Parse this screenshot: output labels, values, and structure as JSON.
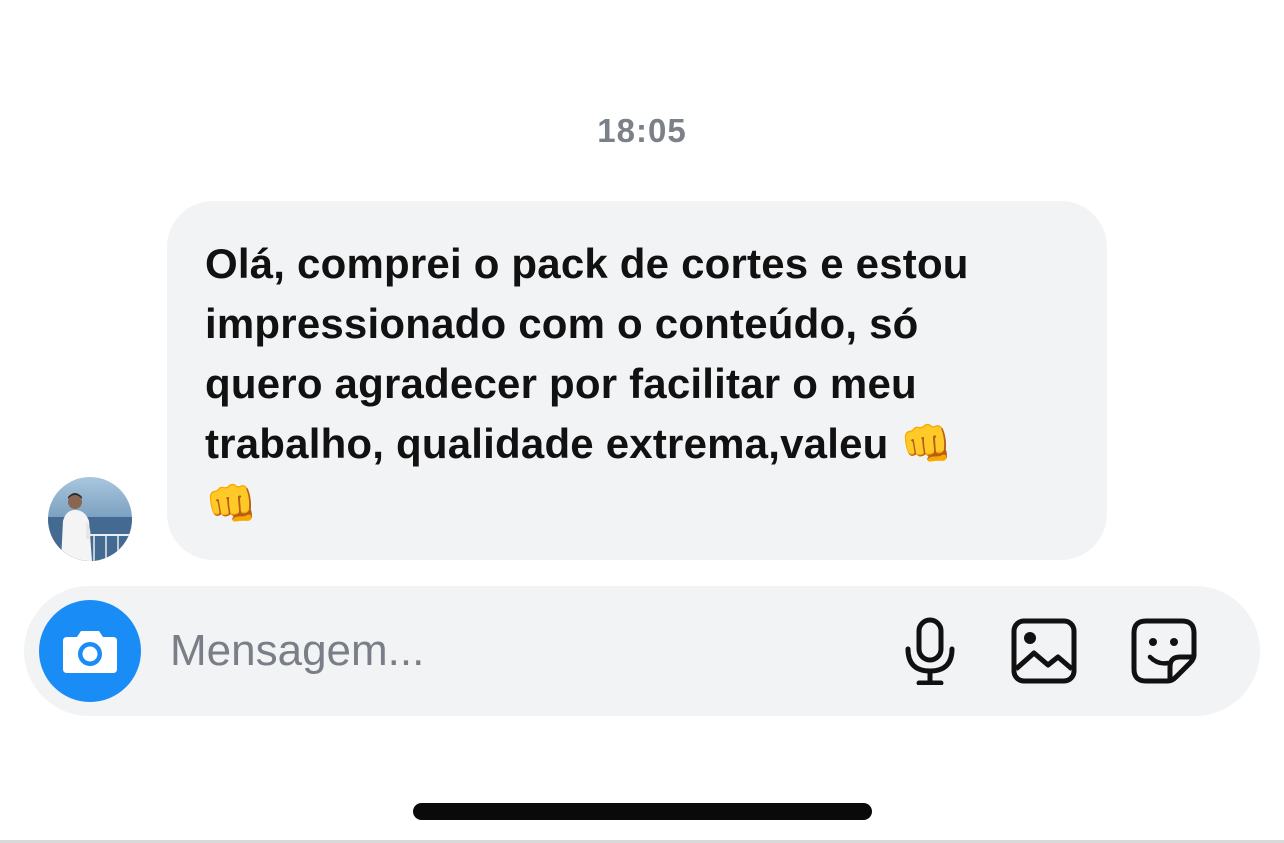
{
  "chat": {
    "timestamp": "18:05",
    "message": {
      "text": "Olá, comprei o pack de cortes e estou\nimpressionado com o conteúdo, só\nquero agradecer por facilitar o meu\ntrabalho, qualidade extrema,valeu 👊\n👊"
    },
    "sender": {
      "avatar_icon": "user-photo-avatar"
    }
  },
  "composer": {
    "placeholder": "Mensagem...",
    "camera_icon": "camera-icon",
    "mic_icon": "microphone-icon",
    "gallery_icon": "image-icon",
    "sticker_icon": "sticker-icon",
    "accent_color": "#1a8cf5"
  },
  "colors": {
    "bubble_background": "#f2f3f5",
    "timestamp_text": "#7c8088",
    "placeholder_text": "#7a7e86"
  }
}
